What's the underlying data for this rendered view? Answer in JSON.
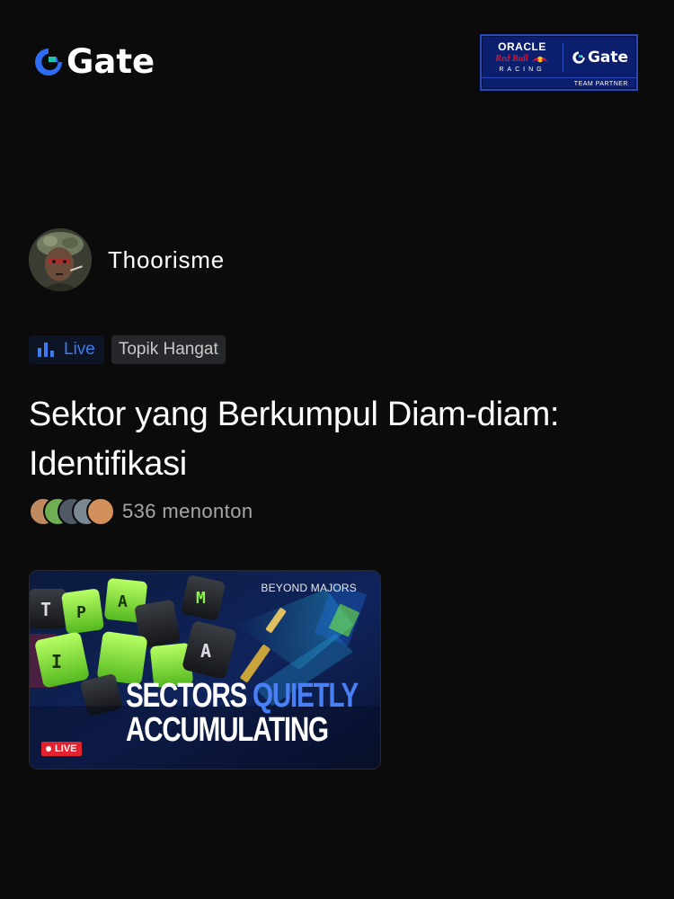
{
  "brand": {
    "name": "Gate",
    "partner": {
      "line1": "ORACLE",
      "line2": "Red Bull",
      "line3": "RACING",
      "brand": "Gate",
      "caption": "TEAM PARTNER"
    }
  },
  "post": {
    "author": "Thoorisme",
    "badges": {
      "live": "Live",
      "topic": "Topik Hangat"
    },
    "title": "Sektor yang Berkumpul Diam-diam: Identifikasi",
    "viewers": "536 menonton"
  },
  "thumbnail": {
    "tag": "BEYOND MAJORS",
    "headline_line1_a": "SECTORS",
    "headline_line1_b": "QUIETLY",
    "headline_line2": "ACCUMULATING",
    "live": "LIVE"
  },
  "colors": {
    "background": "#0b0b0c",
    "gate_blue": "#2e6cf6",
    "gate_teal": "#20c4a8",
    "live_blue": "#3b7cf0",
    "live_red": "#e3222f",
    "keycap_green": "#8fe63a"
  }
}
